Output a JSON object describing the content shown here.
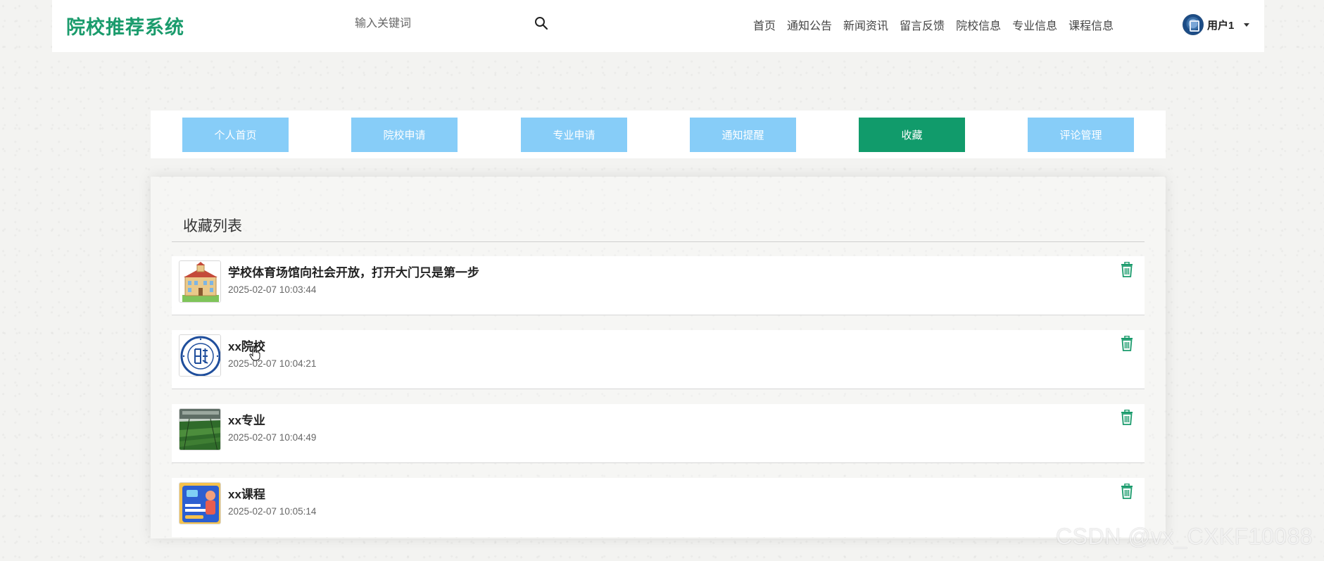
{
  "header": {
    "logo": "院校推荐系统",
    "search_placeholder": "输入关键词",
    "nav": [
      "首页",
      "通知公告",
      "新闻资讯",
      "留言反馈",
      "院校信息",
      "专业信息",
      "课程信息"
    ],
    "username": "用户1"
  },
  "tabs": [
    {
      "label": "个人首页",
      "active": false
    },
    {
      "label": "院校申请",
      "active": false
    },
    {
      "label": "专业申请",
      "active": false
    },
    {
      "label": "通知提醒",
      "active": false
    },
    {
      "label": "收藏",
      "active": true
    },
    {
      "label": "评论管理",
      "active": false
    }
  ],
  "favorites": {
    "title": "收藏列表",
    "items": [
      {
        "title": "学校体育场馆向社会开放，打开大门只是第一步",
        "time": "2025-02-07 10:03:44",
        "thumb": "school-building-image"
      },
      {
        "title": "xx院校",
        "time": "2025-02-07 10:04:21",
        "thumb": "university-seal-image"
      },
      {
        "title": "xx专业",
        "time": "2025-02-07 10:04:49",
        "thumb": "greenhouse-image"
      },
      {
        "title": "xx课程",
        "time": "2025-02-07 10:05:14",
        "thumb": "course-poster-image"
      }
    ]
  },
  "colors": {
    "brand": "#1a9b6c",
    "tab": "#87cdf8",
    "tab_active": "#119b6b",
    "delete": "#1a9b6c"
  },
  "watermark": "CSDN @vx_CXKF10088"
}
